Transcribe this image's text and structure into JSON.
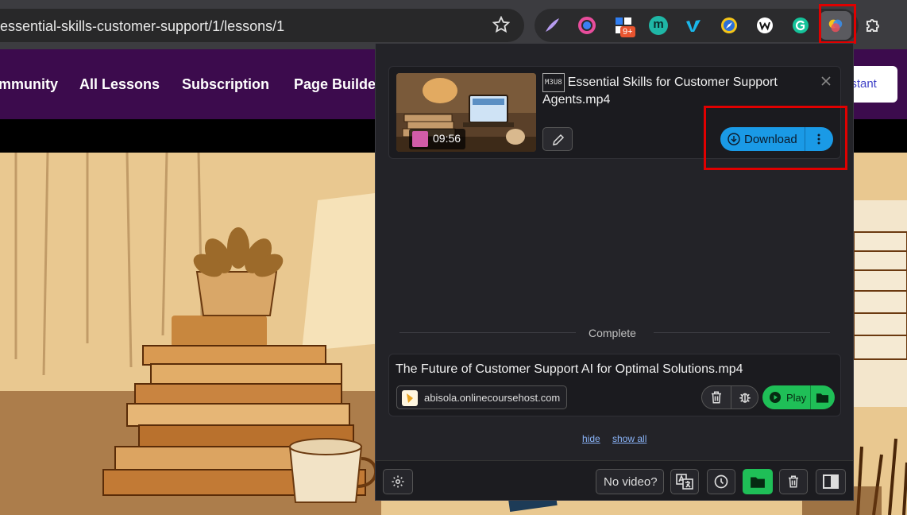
{
  "browser": {
    "url": "essential-skills-customer-support/1/lessons/1",
    "extensions": [
      {
        "name": "quill-icon",
        "color": "#b79cf0"
      },
      {
        "name": "ring-icon",
        "color": "#e84d9c"
      },
      {
        "name": "grid-icon",
        "color": "#2f7ef2"
      },
      {
        "name": "m-icon",
        "color": "#1fb7a6"
      },
      {
        "name": "vimeo-icon",
        "color": "#1ab7ea"
      },
      {
        "name": "compass-icon",
        "color": "#f5c518"
      },
      {
        "name": "w-icon",
        "color": "#ffffff"
      },
      {
        "name": "grammarly-icon",
        "color": "#15c39a"
      }
    ],
    "ext_badge": "9+",
    "ext_m_letter": "m"
  },
  "site": {
    "nav": [
      "mmunity",
      "All Lessons",
      "Subscription",
      "Page Builder"
    ],
    "assistant_label": "istant"
  },
  "popup": {
    "active": {
      "badge": "M3U8",
      "title": "Essential Skills for Customer Support Agents.mp4",
      "duration": "09:56",
      "download_label": "Download"
    },
    "section_label": "Complete",
    "completed": {
      "title": "The Future of Customer Support AI for Optimal Solutions.mp4",
      "site": "abisola.onlinecoursehost.com",
      "play_label": "Play"
    },
    "links": {
      "hide": "hide",
      "show_all": "show all"
    },
    "footer": {
      "no_video": "No video?"
    },
    "colors": {
      "download": "#1a9ae6",
      "play": "#1fbf57",
      "highlight": "#e00000"
    }
  }
}
